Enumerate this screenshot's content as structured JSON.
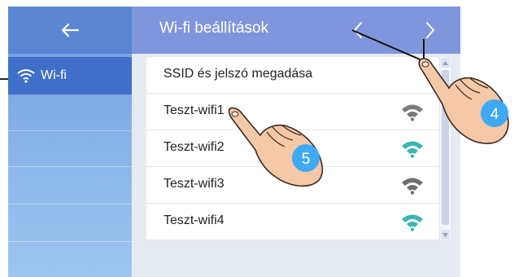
{
  "header": {
    "back_icon": "arrow-left-icon",
    "title": "Wi-fi beállítások",
    "prev_icon": "chevron-left-icon",
    "next_icon": "chevron-right-icon"
  },
  "sidebar": {
    "items": [
      {
        "label": "Wi-fi",
        "icon": "wifi-icon",
        "selected": true
      }
    ]
  },
  "list": {
    "header_item": "SSID és jelszó megadása",
    "networks": [
      {
        "ssid": "Teszt-wifi1",
        "signal_color": "#7a7a7a"
      },
      {
        "ssid": "Teszt-wifi2",
        "signal_color": "#3bb6b0"
      },
      {
        "ssid": "Teszt-wifi3",
        "signal_color": "#6f6f6f"
      },
      {
        "ssid": "Teszt-wifi4",
        "signal_color": "#3bb6b0"
      }
    ]
  },
  "annotations": {
    "step_prev_next": "4",
    "step_select_network": "5"
  },
  "colors": {
    "sidebar_header": "#5b86d3",
    "sidebar_selected": "#3f6fc8",
    "main_header": "#7f96dc",
    "badge": "#3fa9f5"
  }
}
